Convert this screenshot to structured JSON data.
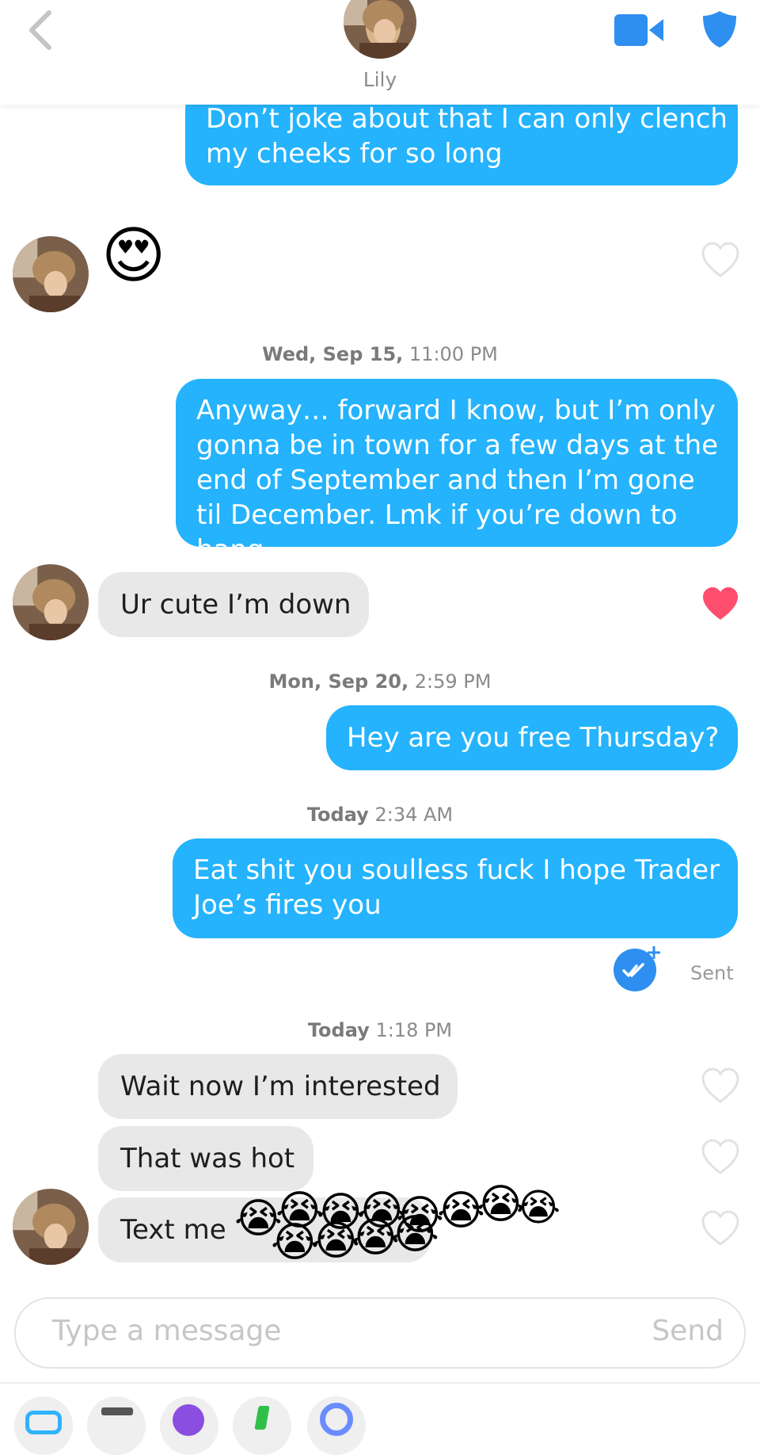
{
  "header": {
    "contact_name": "Lily",
    "back_icon": "chevron-left-icon",
    "video_icon": "video-camera-icon",
    "safety_icon": "shield-icon",
    "accent_color": "#2e8ff0"
  },
  "messages": [
    {
      "dir": "out",
      "text": "Don’t joke about that I can only clench my cheeks for so long"
    },
    {
      "dir": "in",
      "text": "😍",
      "liked": false
    },
    {
      "timestamp_day": "Wed, Sep 15,",
      "timestamp_time": "11:00 PM"
    },
    {
      "dir": "out",
      "text": "Anyway… forward I know, but I’m only gonna be in town for a few days at the end of September and then I’m gone til December. Lmk if you’re down to hang"
    },
    {
      "dir": "in",
      "text": "Ur cute I’m down",
      "liked": true
    },
    {
      "timestamp_day": "Mon, Sep 20,",
      "timestamp_time": "2:59 PM"
    },
    {
      "dir": "out",
      "text": "Hey are you free Thursday?"
    },
    {
      "timestamp_day": "Today",
      "timestamp_time": "2:34 AM"
    },
    {
      "dir": "out",
      "text": "Eat shit you soulless fuck I hope Trader Joe’s fires you",
      "status": "Sent"
    },
    {
      "timestamp_day": "Today",
      "timestamp_time": "1:18 PM"
    },
    {
      "dir": "in",
      "text": "Wait now I’m interested",
      "liked": false
    },
    {
      "dir": "in",
      "text": "That was hot",
      "liked": false
    },
    {
      "dir": "in",
      "text": "Text me",
      "liked": false
    }
  ],
  "overlay_emoji": "😭",
  "composer": {
    "placeholder": "Type a message",
    "send_label": "Send"
  },
  "colors": {
    "outgoing_bubble": "#24b3fc",
    "incoming_bubble": "#e8e8e8",
    "like_heart": "#ff4d6d",
    "read_receipt": "#2e8ff0"
  }
}
